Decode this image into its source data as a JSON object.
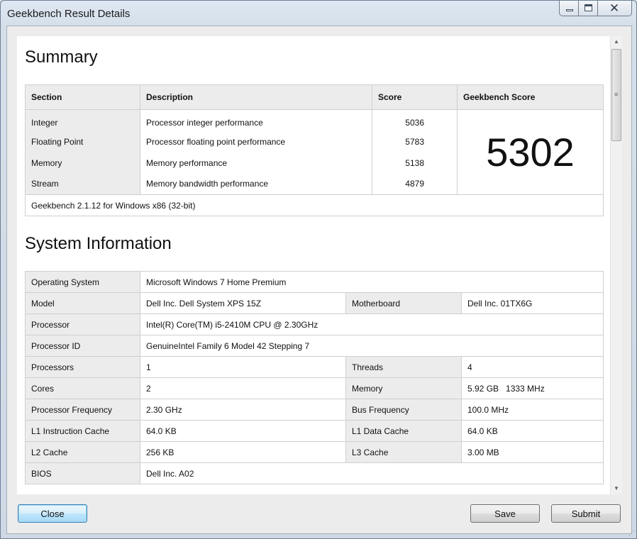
{
  "window": {
    "title": "Geekbench Result Details"
  },
  "icons": {
    "minimize": "minimize-icon",
    "maximize": "maximize-icon",
    "close": "close-icon",
    "close_glyph": "✕"
  },
  "summary": {
    "title": "Summary",
    "headers": {
      "section": "Section",
      "description": "Description",
      "score": "Score",
      "geekbench_score": "Geekbench Score"
    },
    "rows": [
      {
        "section": "Integer",
        "description": "Processor integer performance",
        "score": "5036"
      },
      {
        "section": "Floating Point",
        "description": "Processor floating point performance",
        "score": "5783"
      },
      {
        "section": "Memory",
        "description": "Memory performance",
        "score": "5138"
      },
      {
        "section": "Stream",
        "description": "Memory bandwidth performance",
        "score": "4879"
      }
    ],
    "geekbench_score": "5302",
    "footer": "Geekbench 2.1.12 for Windows x86 (32-bit)"
  },
  "system_info": {
    "title": "System Information",
    "operating_system": {
      "label": "Operating System",
      "value": "Microsoft Windows 7 Home Premium"
    },
    "model": {
      "label": "Model",
      "value": "Dell Inc. Dell System XPS 15Z"
    },
    "motherboard": {
      "label": "Motherboard",
      "value": "Dell Inc. 01TX6G"
    },
    "processor": {
      "label": "Processor",
      "value": "Intel(R) Core(TM) i5-2410M CPU @ 2.30GHz"
    },
    "processor_id": {
      "label": "Processor ID",
      "value": "GenuineIntel Family 6 Model 42 Stepping 7"
    },
    "processors": {
      "label": "Processors",
      "value": "1"
    },
    "threads": {
      "label": "Threads",
      "value": "4"
    },
    "cores": {
      "label": "Cores",
      "value": "2"
    },
    "memory": {
      "label": "Memory",
      "value": "5.92 GB   1333 MHz"
    },
    "processor_frequency": {
      "label": "Processor Frequency",
      "value": "2.30 GHz"
    },
    "bus_frequency": {
      "label": "Bus Frequency",
      "value": "100.0 MHz"
    },
    "l1_instruction_cache": {
      "label": "L1 Instruction Cache",
      "value": "64.0 KB"
    },
    "l1_data_cache": {
      "label": "L1 Data Cache",
      "value": "64.0 KB"
    },
    "l2_cache": {
      "label": "L2 Cache",
      "value": "256 KB"
    },
    "l3_cache": {
      "label": "L3 Cache",
      "value": "3.00 MB"
    },
    "bios": {
      "label": "BIOS",
      "value": "Dell Inc. A02"
    }
  },
  "buttons": {
    "close": "Close",
    "save": "Save",
    "submit": "Submit"
  }
}
